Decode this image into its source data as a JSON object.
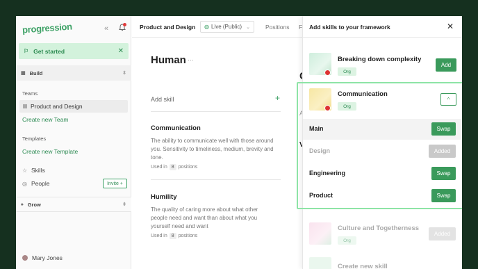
{
  "sidebar": {
    "logo": "progression",
    "get_started": "Get started",
    "build_label": "Build",
    "teams_label": "Teams",
    "team_item": "Product and Design",
    "create_team": "Create new Team",
    "templates_label": "Templates",
    "create_template": "Create new Template",
    "skills": "Skills",
    "people": "People",
    "invite": "Invite +",
    "grow_label": "Grow",
    "user_name": "Mary Jones"
  },
  "topbar": {
    "title": "Product and Design",
    "live_select": "Live (Public)",
    "tab_positions": "Positions",
    "tab_f": "Fr"
  },
  "main": {
    "column_title": "Human",
    "more": "···",
    "add_skill": "Add skill",
    "add_plus": "+",
    "skills": [
      {
        "name": "Communication",
        "description": "The ability to communicate well with those around you. Sensitivity to timeliness, medium, brevity and tone.",
        "used_prefix": "Used in",
        "used_count": "8",
        "used_suffix": "positions"
      },
      {
        "name": "Humility",
        "description": "The quality of caring more about what other people need and want than about what you yourself need and want",
        "used_prefix": "Used in",
        "used_count": "8",
        "used_suffix": "positions"
      }
    ],
    "ghost_o": "C",
    "ghost_a": "A",
    "ghost_v": "V"
  },
  "panel": {
    "title": "Add skills to your framework",
    "close": "✕",
    "cards": [
      {
        "title": "Breaking down complexity",
        "badge": "Org",
        "action": "Add"
      },
      {
        "title": "Communication",
        "badge": "Org",
        "action": "^"
      },
      {
        "title": "Culture and Togetherness",
        "badge": "Org",
        "action": "Added"
      },
      {
        "title": "Create new skill"
      }
    ],
    "positions": [
      {
        "label": "Main",
        "action": "Swap"
      },
      {
        "label": "Design",
        "action": "Added"
      },
      {
        "label": "Engineering",
        "action": "Swap"
      },
      {
        "label": "Product",
        "action": "Swap"
      }
    ]
  },
  "colors": {
    "brand_green": "#3fa267",
    "background": "#15301f",
    "highlight": "#8ee4a6",
    "get_started_bg": "#d3f2dc"
  }
}
